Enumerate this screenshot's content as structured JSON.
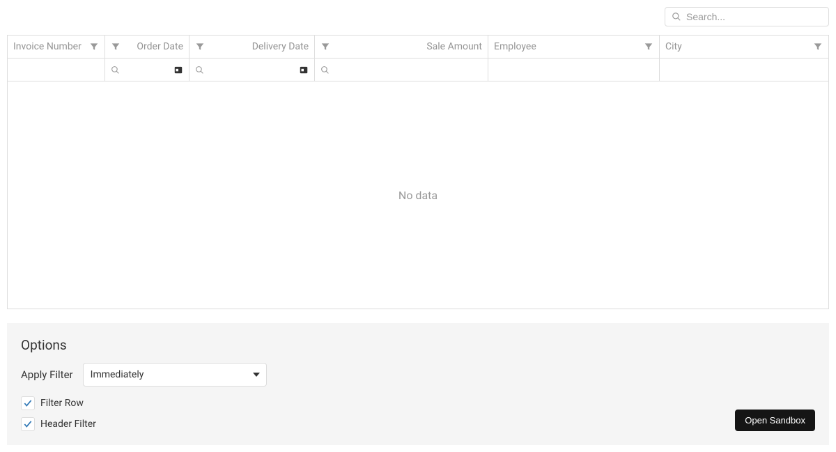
{
  "search": {
    "placeholder": "Search..."
  },
  "columns": {
    "invoice": "Invoice Number",
    "order": "Order Date",
    "delivery": "Delivery Date",
    "sale": "Sale Amount",
    "employee": "Employee",
    "city": "City"
  },
  "grid": {
    "empty": "No data"
  },
  "options": {
    "title": "Options",
    "apply_label": "Apply Filter",
    "apply_value": "Immediately",
    "filter_row_label": "Filter Row",
    "header_filter_label": "Header Filter"
  },
  "sandbox": {
    "label": "Open Sandbox"
  }
}
